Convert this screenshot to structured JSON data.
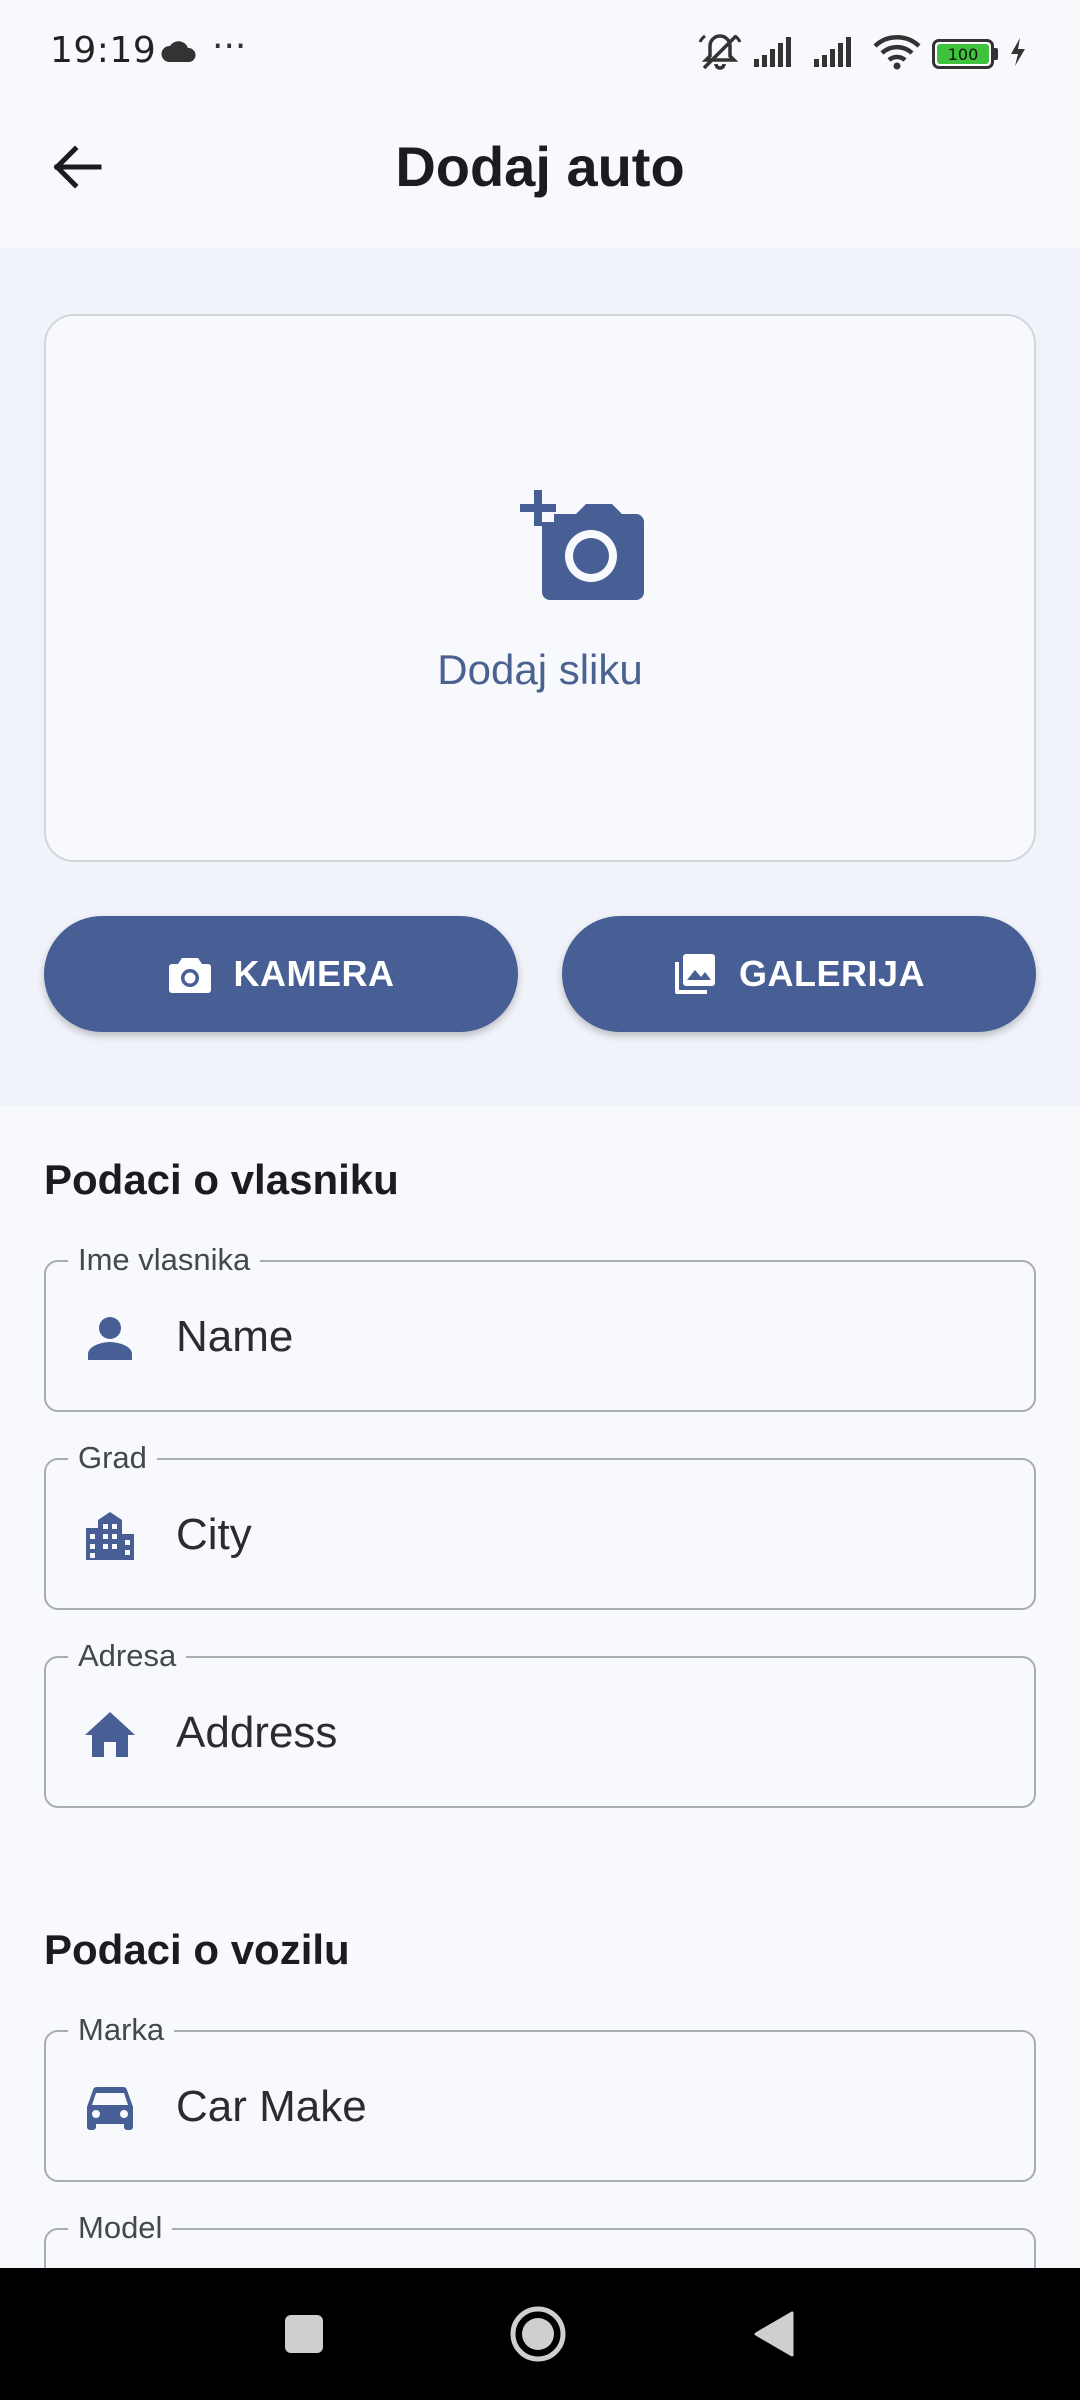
{
  "status_bar": {
    "time": "19:19",
    "battery": "100",
    "icons": [
      "cloud-icon",
      "more-dots-icon",
      "mute-icon",
      "signal-icon",
      "signal-icon",
      "wifi-icon",
      "battery-icon",
      "charging-icon"
    ]
  },
  "app_bar": {
    "title": "Dodaj auto",
    "back_icon": "arrow-back-icon"
  },
  "photo": {
    "label": "Dodaj sliku",
    "icon": "add-a-photo-icon"
  },
  "buttons": {
    "camera": {
      "label": "KAMERA",
      "icon": "camera-icon"
    },
    "gallery": {
      "label": "GALERIJA",
      "icon": "photo-library-icon"
    }
  },
  "owner_section": {
    "title": "Podaci o vlasniku",
    "fields": [
      {
        "label": "Ime vlasnika",
        "placeholder": "Name",
        "icon": "person-icon"
      },
      {
        "label": "Grad",
        "placeholder": "City",
        "icon": "city-icon"
      },
      {
        "label": "Adresa",
        "placeholder": "Address",
        "icon": "home-icon"
      }
    ]
  },
  "vehicle_section": {
    "title": "Podaci o vozilu",
    "fields": [
      {
        "label": "Marka",
        "placeholder": "Car Make",
        "icon": "car-icon"
      },
      {
        "label": "Model",
        "placeholder": "",
        "icon": ""
      }
    ]
  },
  "colors": {
    "primary": "#475f94",
    "background": "#f8f9fd",
    "section_bg": "#f1f3fa",
    "outline": "#a9acb3"
  },
  "nav_bar": {
    "icons": [
      "recents-square-icon",
      "home-circle-icon",
      "back-triangle-icon"
    ]
  }
}
